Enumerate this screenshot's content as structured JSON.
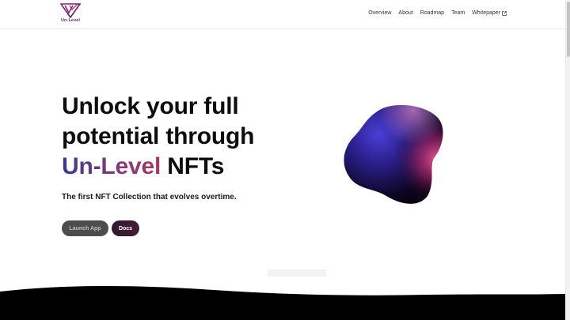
{
  "nav": {
    "logo_text": "Un-Level",
    "links": [
      {
        "label": "Overview"
      },
      {
        "label": "About"
      },
      {
        "label": "Roadmap"
      },
      {
        "label": "Team"
      },
      {
        "label": "Whitepaper"
      }
    ]
  },
  "hero": {
    "title_line1": "Unlock your full",
    "title_line2": "potential through",
    "title_brand": "Un-Level",
    "title_suffix": " NFTs",
    "subtitle": "The first NFT Collection that evolves overtime.",
    "launch_label": "Launch App",
    "docs_label": "Docs"
  },
  "colors": {
    "brand_start": "#3c3a8a",
    "brand_end": "#a3395f",
    "logo": "#6b1d5f",
    "footer": "#000000"
  },
  "icons": {
    "logo": "triangle-v-logo-icon",
    "external": "external-link-icon"
  }
}
